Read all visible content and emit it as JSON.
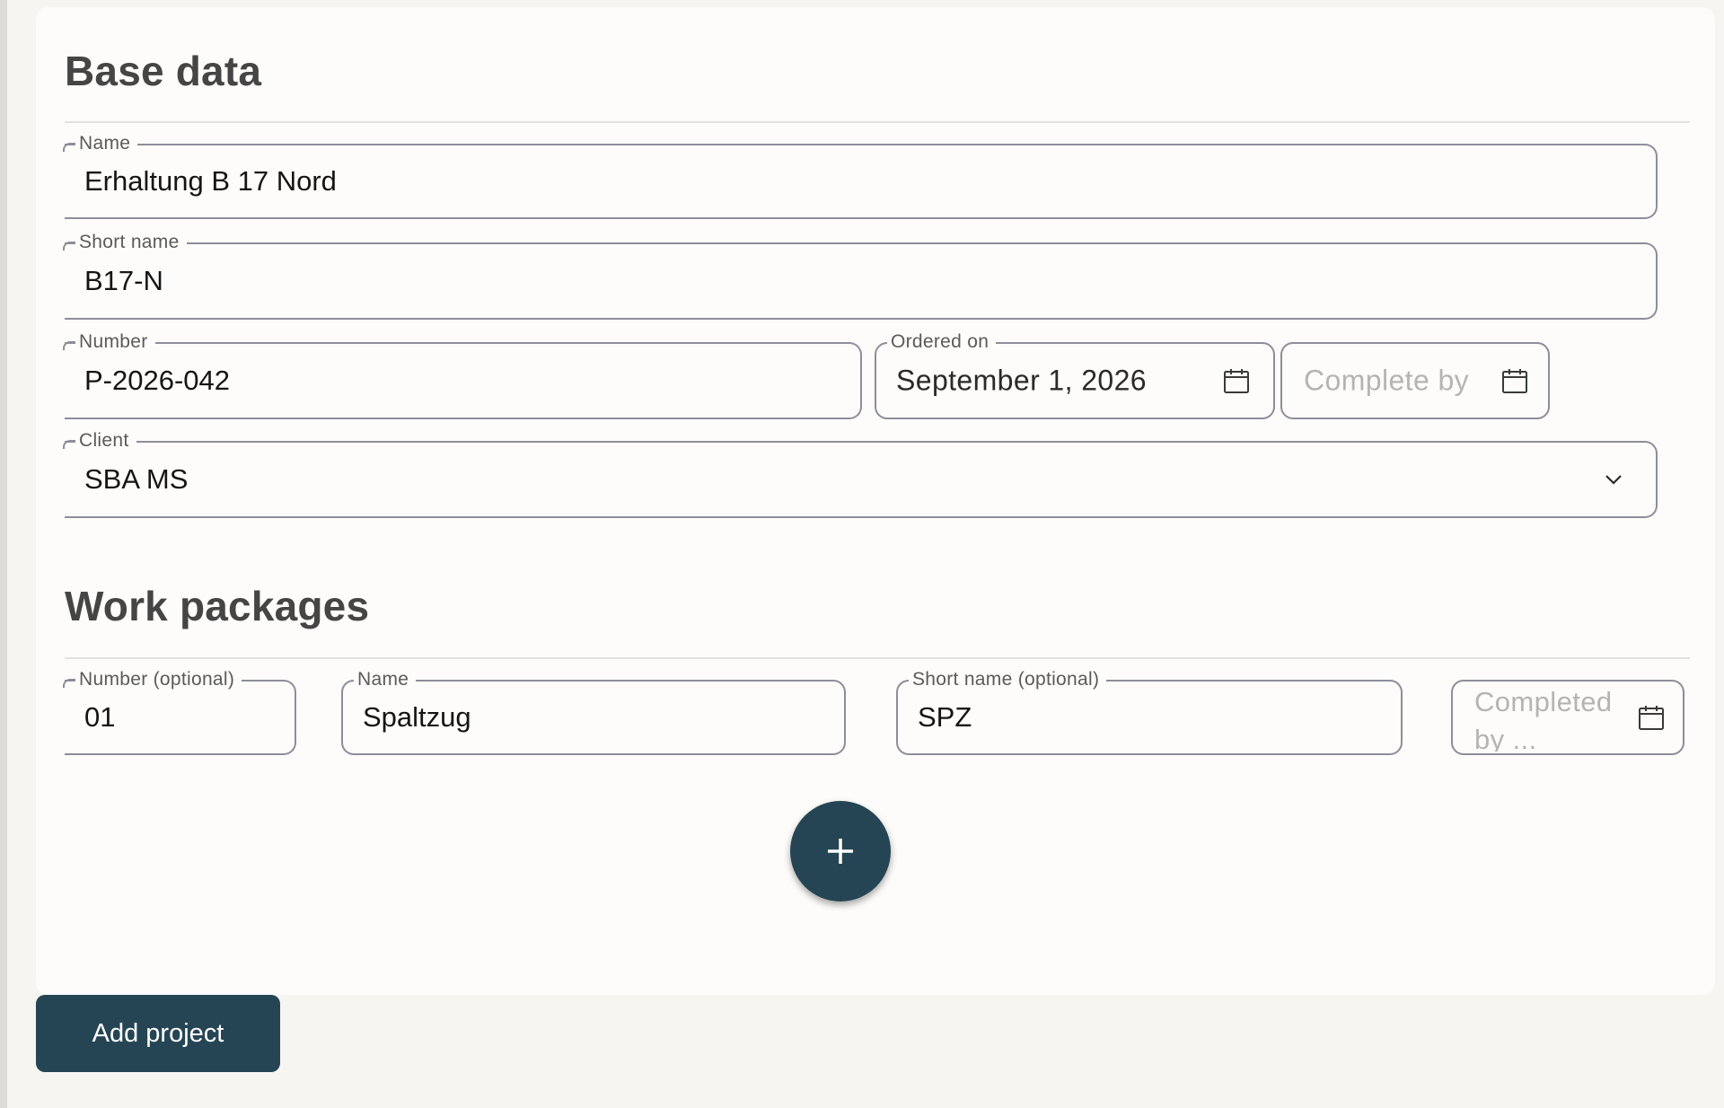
{
  "base_data": {
    "title": "Base data",
    "name": {
      "label": "Name",
      "value": "Erhaltung B 17 Nord"
    },
    "short_name": {
      "label": "Short name",
      "value": "B17-N"
    },
    "number": {
      "label": "Number",
      "value": "P-2026-042"
    },
    "ordered_on": {
      "label": "Ordered on",
      "value": "September 1, 2026"
    },
    "complete_by": {
      "placeholder": "Complete by"
    },
    "client": {
      "label": "Client",
      "value": "SBA MS"
    }
  },
  "work_packages": {
    "title": "Work packages",
    "number": {
      "label": "Number (optional)",
      "value": "01"
    },
    "name": {
      "label": "Name",
      "value": "Spaltzug"
    },
    "short_name": {
      "label": "Short name (optional)",
      "value": "SPZ"
    },
    "completed_by": {
      "placeholder": "Completed by ..."
    }
  },
  "actions": {
    "add_work_package_icon": "plus-icon",
    "add_project_label": "Add project"
  },
  "colors": {
    "accent": "#264554",
    "field_border": "#8e8d9a",
    "card_background": "#fdfcfa",
    "page_background": "#f6f5f2"
  },
  "icons": {
    "date_picker": "calendar-icon",
    "dropdown": "chevron-down-icon"
  }
}
